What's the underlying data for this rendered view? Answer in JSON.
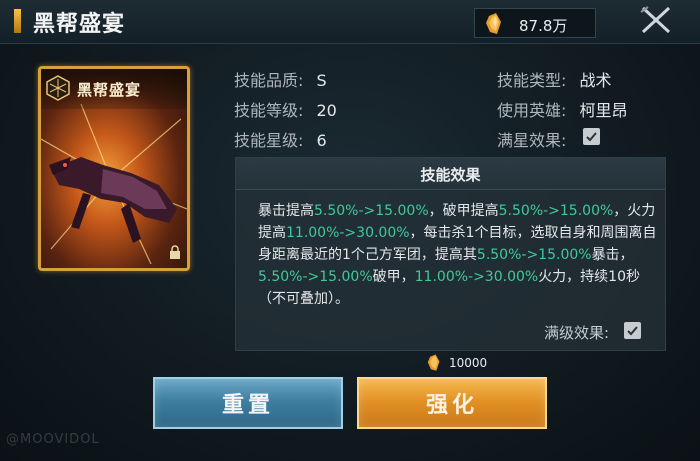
{
  "window": {
    "title": "黑帮盛宴",
    "currency": {
      "icon": "crystal-icon",
      "value": "87.8万"
    },
    "close_icon": "close-icon"
  },
  "card": {
    "title": "黑帮盛宴",
    "emblem_icon": "faction-emblem-icon",
    "lock_icon": "lock-icon"
  },
  "stats": {
    "quality_label": "技能品质:",
    "quality_value": "S",
    "level_label": "技能等级:",
    "level_value": "20",
    "star_label": "技能星级:",
    "star_value": "6",
    "type_label": "技能类型:",
    "type_value": "战术",
    "hero_label": "使用英雄:",
    "hero_value": "柯里昂",
    "fullstar_label": "满星效果:",
    "fullstar_checked": true
  },
  "effect": {
    "title": "技能效果",
    "segments": [
      {
        "t": "暴击提高",
        "hl": false
      },
      {
        "t": "5.50%->15.00%",
        "hl": true
      },
      {
        "t": "，破甲提高",
        "hl": false
      },
      {
        "t": "5.50%->15.00%",
        "hl": true
      },
      {
        "t": "，火力提高",
        "hl": false
      },
      {
        "t": "11.00%->30.00%",
        "hl": true
      },
      {
        "t": "，每击杀1个目标，选取自身和周围离自身距离最近的1个己方军团，提高其",
        "hl": false
      },
      {
        "t": "5.50%->15.00%",
        "hl": true
      },
      {
        "t": "暴击，",
        "hl": false
      },
      {
        "t": "5.50%->15.00%",
        "hl": true
      },
      {
        "t": "破甲，",
        "hl": false
      },
      {
        "t": "11.00%->30.00%",
        "hl": true
      },
      {
        "t": "火力，持续10秒（不可叠加）。",
        "hl": false
      }
    ],
    "max_label": "满级效果:",
    "max_checked": true
  },
  "cost": {
    "icon": "crystal-icon",
    "value": "10000"
  },
  "buttons": {
    "reset": "重置",
    "enhance": "强化"
  },
  "watermark": "@MOOVIDOL",
  "colors": {
    "highlight": "#3fc99b",
    "gold": "#d6a13b",
    "reset_blue": "#3f7fa1",
    "enhance_orange": "#e08f22"
  }
}
